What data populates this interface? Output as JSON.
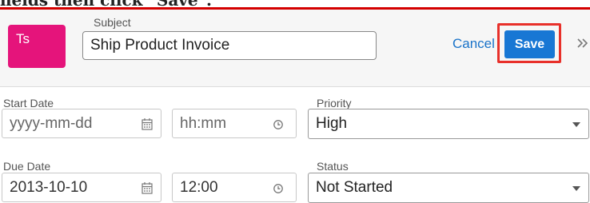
{
  "caption": {
    "text": "fields then click \"Save\"."
  },
  "record": {
    "avatar_initials": "Ts",
    "subject_label": "Subject",
    "subject_value": "Ship Product Invoice"
  },
  "actions": {
    "cancel_label": "Cancel",
    "save_label": "Save",
    "expand_glyph": "»"
  },
  "fields": {
    "start_date": {
      "label": "Start Date",
      "date_placeholder": "yyyy-mm-dd",
      "time_placeholder": "hh:mm"
    },
    "priority": {
      "label": "Priority",
      "value": "High"
    },
    "due_date": {
      "label": "Due Date",
      "date_value": "2013-10-10",
      "time_value": "12:00"
    },
    "status": {
      "label": "Status",
      "value": "Not Started"
    }
  },
  "colors": {
    "avatar": "#e5147b",
    "save_button": "#1877d4",
    "highlight": "#e8302a",
    "link": "#1a73c9"
  }
}
